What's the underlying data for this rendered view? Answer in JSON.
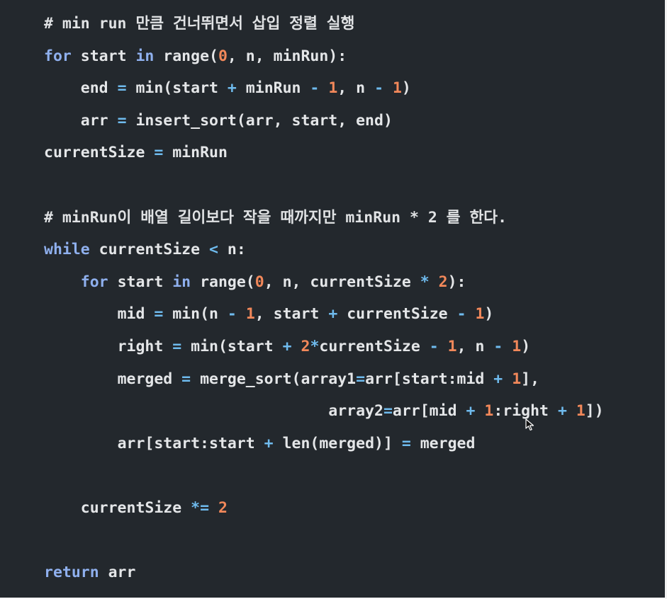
{
  "editor": {
    "language": "python",
    "colors": {
      "background": "#23282d",
      "text": "#e4e6e8",
      "keyword": "#8fb0ee",
      "number": "#f2885a",
      "operator": "#6fbbee",
      "comment": "#e0e2e4"
    },
    "lines": [
      {
        "indent": 0,
        "tokens": [
          {
            "t": "comment",
            "v": "# min run 만큼 건너뛰면서 삽입 정렬 실행"
          }
        ]
      },
      {
        "indent": 0,
        "tokens": [
          {
            "t": "kw",
            "v": "for"
          },
          {
            "t": "plain",
            "v": " start "
          },
          {
            "t": "kw",
            "v": "in"
          },
          {
            "t": "plain",
            "v": " range("
          },
          {
            "t": "num",
            "v": "0"
          },
          {
            "t": "plain",
            "v": ", n, minRun):"
          }
        ]
      },
      {
        "indent": 1,
        "tokens": [
          {
            "t": "plain",
            "v": "end "
          },
          {
            "t": "op",
            "v": "="
          },
          {
            "t": "plain",
            "v": " min(start "
          },
          {
            "t": "op",
            "v": "+"
          },
          {
            "t": "plain",
            "v": " minRun "
          },
          {
            "t": "op",
            "v": "-"
          },
          {
            "t": "plain",
            "v": " "
          },
          {
            "t": "num",
            "v": "1"
          },
          {
            "t": "plain",
            "v": ", n "
          },
          {
            "t": "op",
            "v": "-"
          },
          {
            "t": "plain",
            "v": " "
          },
          {
            "t": "num",
            "v": "1"
          },
          {
            "t": "plain",
            "v": ")"
          }
        ]
      },
      {
        "indent": 1,
        "tokens": [
          {
            "t": "plain",
            "v": "arr "
          },
          {
            "t": "op",
            "v": "="
          },
          {
            "t": "plain",
            "v": " insert_sort(arr, start, end)"
          }
        ]
      },
      {
        "indent": 0,
        "tokens": [
          {
            "t": "plain",
            "v": "currentSize "
          },
          {
            "t": "op",
            "v": "="
          },
          {
            "t": "plain",
            "v": " minRun"
          }
        ]
      },
      {
        "indent": 0,
        "tokens": []
      },
      {
        "indent": 0,
        "tokens": [
          {
            "t": "comment",
            "v": "# minRun이 배열 길이보다 작을 때까지만 minRun * 2 를 한다."
          }
        ]
      },
      {
        "indent": 0,
        "tokens": [
          {
            "t": "kw",
            "v": "while"
          },
          {
            "t": "plain",
            "v": " currentSize "
          },
          {
            "t": "op",
            "v": "<"
          },
          {
            "t": "plain",
            "v": " n:"
          }
        ]
      },
      {
        "indent": 1,
        "tokens": [
          {
            "t": "kw",
            "v": "for"
          },
          {
            "t": "plain",
            "v": " start "
          },
          {
            "t": "kw",
            "v": "in"
          },
          {
            "t": "plain",
            "v": " range("
          },
          {
            "t": "num",
            "v": "0"
          },
          {
            "t": "plain",
            "v": ", n, currentSize "
          },
          {
            "t": "op",
            "v": "*"
          },
          {
            "t": "plain",
            "v": " "
          },
          {
            "t": "num",
            "v": "2"
          },
          {
            "t": "plain",
            "v": "):"
          }
        ]
      },
      {
        "indent": 2,
        "tokens": [
          {
            "t": "plain",
            "v": "mid "
          },
          {
            "t": "op",
            "v": "="
          },
          {
            "t": "plain",
            "v": " min(n "
          },
          {
            "t": "op",
            "v": "-"
          },
          {
            "t": "plain",
            "v": " "
          },
          {
            "t": "num",
            "v": "1"
          },
          {
            "t": "plain",
            "v": ", start "
          },
          {
            "t": "op",
            "v": "+"
          },
          {
            "t": "plain",
            "v": " currentSize "
          },
          {
            "t": "op",
            "v": "-"
          },
          {
            "t": "plain",
            "v": " "
          },
          {
            "t": "num",
            "v": "1"
          },
          {
            "t": "plain",
            "v": ")"
          }
        ]
      },
      {
        "indent": 2,
        "tokens": [
          {
            "t": "plain",
            "v": "right "
          },
          {
            "t": "op",
            "v": "="
          },
          {
            "t": "plain",
            "v": " min(start "
          },
          {
            "t": "op",
            "v": "+"
          },
          {
            "t": "plain",
            "v": " "
          },
          {
            "t": "num",
            "v": "2"
          },
          {
            "t": "op",
            "v": "*"
          },
          {
            "t": "plain",
            "v": "currentSize "
          },
          {
            "t": "op",
            "v": "-"
          },
          {
            "t": "plain",
            "v": " "
          },
          {
            "t": "num",
            "v": "1"
          },
          {
            "t": "plain",
            "v": ", n "
          },
          {
            "t": "op",
            "v": "-"
          },
          {
            "t": "plain",
            "v": " "
          },
          {
            "t": "num",
            "v": "1"
          },
          {
            "t": "plain",
            "v": ")"
          }
        ]
      },
      {
        "indent": 2,
        "tokens": [
          {
            "t": "plain",
            "v": "merged "
          },
          {
            "t": "op",
            "v": "="
          },
          {
            "t": "plain",
            "v": " merge_sort(array1"
          },
          {
            "t": "op",
            "v": "="
          },
          {
            "t": "plain",
            "v": "arr[start:mid "
          },
          {
            "t": "op",
            "v": "+"
          },
          {
            "t": "plain",
            "v": " "
          },
          {
            "t": "num",
            "v": "1"
          },
          {
            "t": "plain",
            "v": "],"
          }
        ]
      },
      {
        "indent": 2,
        "tokens": [
          {
            "t": "plain",
            "v": "                       array2"
          },
          {
            "t": "op",
            "v": "="
          },
          {
            "t": "plain",
            "v": "arr[mid "
          },
          {
            "t": "op",
            "v": "+"
          },
          {
            "t": "plain",
            "v": " "
          },
          {
            "t": "num",
            "v": "1"
          },
          {
            "t": "plain",
            "v": ":right "
          },
          {
            "t": "op",
            "v": "+"
          },
          {
            "t": "plain",
            "v": " "
          },
          {
            "t": "num",
            "v": "1"
          },
          {
            "t": "plain",
            "v": "])"
          }
        ]
      },
      {
        "indent": 2,
        "tokens": [
          {
            "t": "plain",
            "v": "arr[start:start "
          },
          {
            "t": "op",
            "v": "+"
          },
          {
            "t": "plain",
            "v": " len(merged)] "
          },
          {
            "t": "op",
            "v": "="
          },
          {
            "t": "plain",
            "v": " merged"
          }
        ]
      },
      {
        "indent": 0,
        "tokens": []
      },
      {
        "indent": 1,
        "tokens": [
          {
            "t": "plain",
            "v": "currentSize "
          },
          {
            "t": "op",
            "v": "*="
          },
          {
            "t": "plain",
            "v": " "
          },
          {
            "t": "num",
            "v": "2"
          }
        ]
      },
      {
        "indent": 0,
        "tokens": []
      },
      {
        "indent": 0,
        "tokens": [
          {
            "t": "kw",
            "v": "return"
          },
          {
            "t": "plain",
            "v": " arr"
          }
        ]
      }
    ],
    "cursor_icon": "mouse-pointer-icon"
  }
}
